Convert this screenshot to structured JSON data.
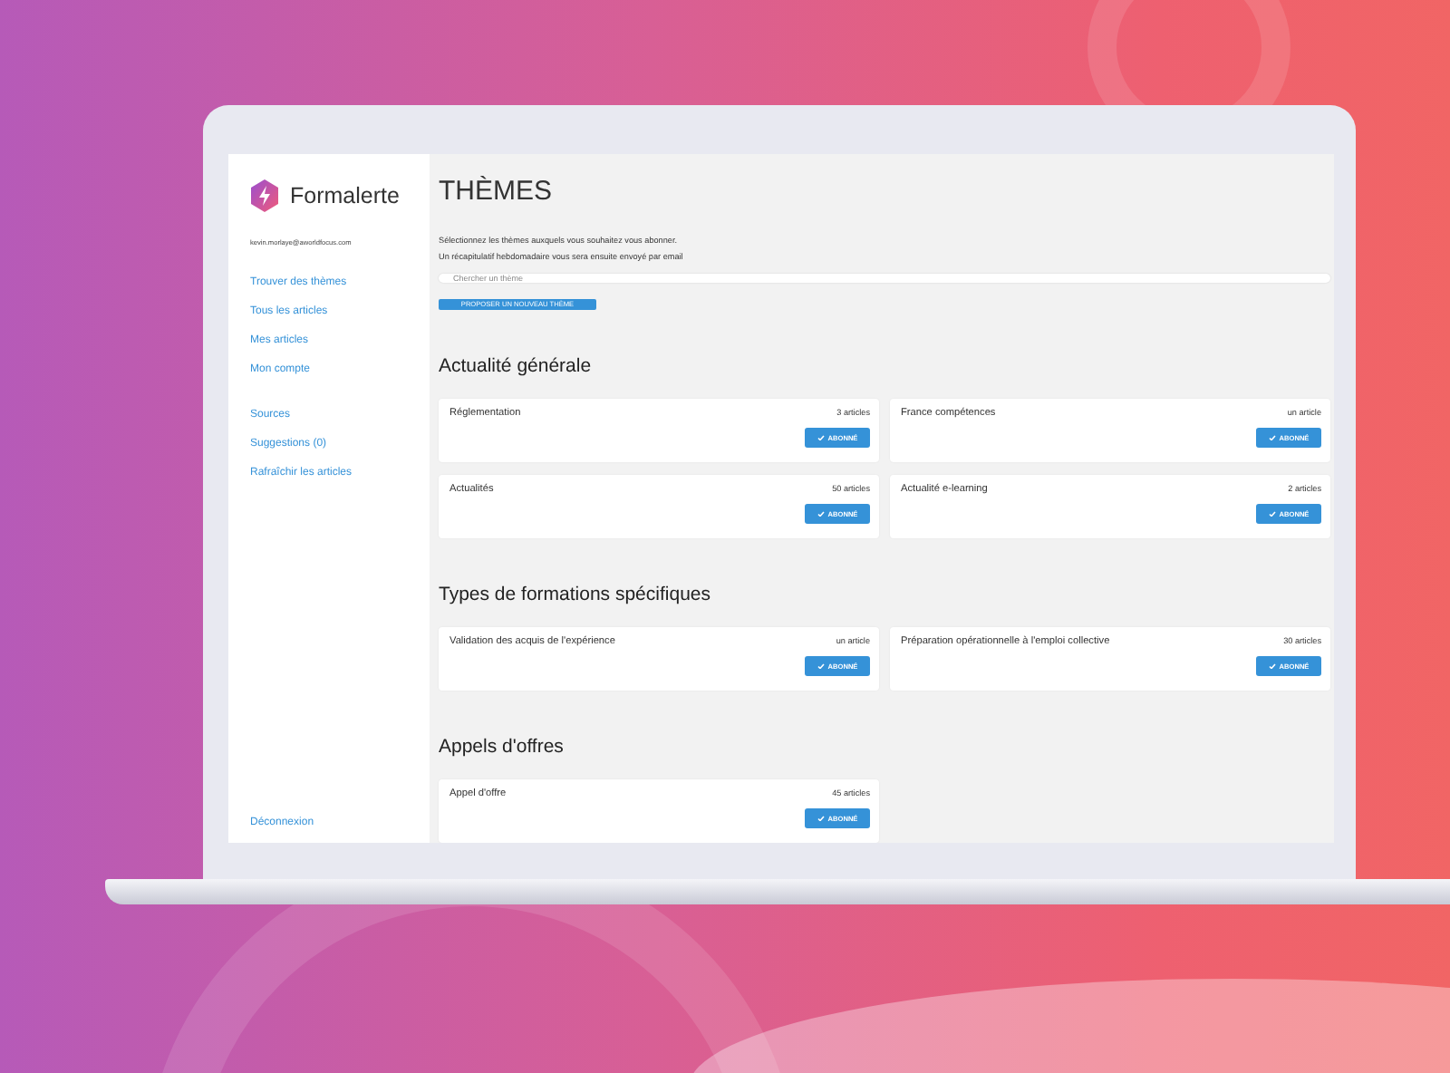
{
  "sidebar": {
    "brand": "Formalerte",
    "email": "kevin.morlaye@aworldfocus.com",
    "nav_groups": [
      [
        {
          "label": "Trouver des thèmes"
        },
        {
          "label": "Tous les articles"
        },
        {
          "label": "Mes articles"
        },
        {
          "label": "Mon compte"
        }
      ],
      [
        {
          "label": "Sources"
        },
        {
          "label": "Suggestions (0)"
        },
        {
          "label": "Rafraîchir les articles"
        }
      ]
    ],
    "logout": "Déconnexion"
  },
  "main": {
    "title": "THÈMES",
    "intro": [
      "Sélectionnez les thèmes auxquels vous souhaitez vous abonner.",
      "Un récapitulatif hebdomadaire vous sera ensuite envoyé par email"
    ],
    "search": {
      "placeholder": "Chercher un thème"
    },
    "propose_button": "PROPOSER UN NOUVEAU THÈME",
    "sections": [
      {
        "heading": "Actualité générale",
        "themes": [
          {
            "name": "Réglementation",
            "count": "3 articles",
            "subscribed": true,
            "button": "ABONNÉ"
          },
          {
            "name": "France compétences",
            "count": "un article",
            "subscribed": true,
            "button": "ABONNÉ"
          },
          {
            "name": "Actualités",
            "count": "50 articles",
            "subscribed": true,
            "button": "ABONNÉ"
          },
          {
            "name": "Actualité e-learning",
            "count": "2 articles",
            "subscribed": true,
            "button": "ABONNÉ"
          }
        ]
      },
      {
        "heading": "Types de formations spécifiques",
        "themes": [
          {
            "name": "Validation des acquis de l'expérience",
            "count": "un article",
            "subscribed": true,
            "button": "ABONNÉ"
          },
          {
            "name": "Préparation opérationnelle à l'emploi collective",
            "count": "30 articles",
            "subscribed": true,
            "button": "ABONNÉ"
          }
        ]
      },
      {
        "heading": "Appels d'offres",
        "themes": [
          {
            "name": "Appel d'offre",
            "count": "45 articles",
            "subscribed": true,
            "button": "ABONNÉ"
          }
        ]
      }
    ]
  }
}
